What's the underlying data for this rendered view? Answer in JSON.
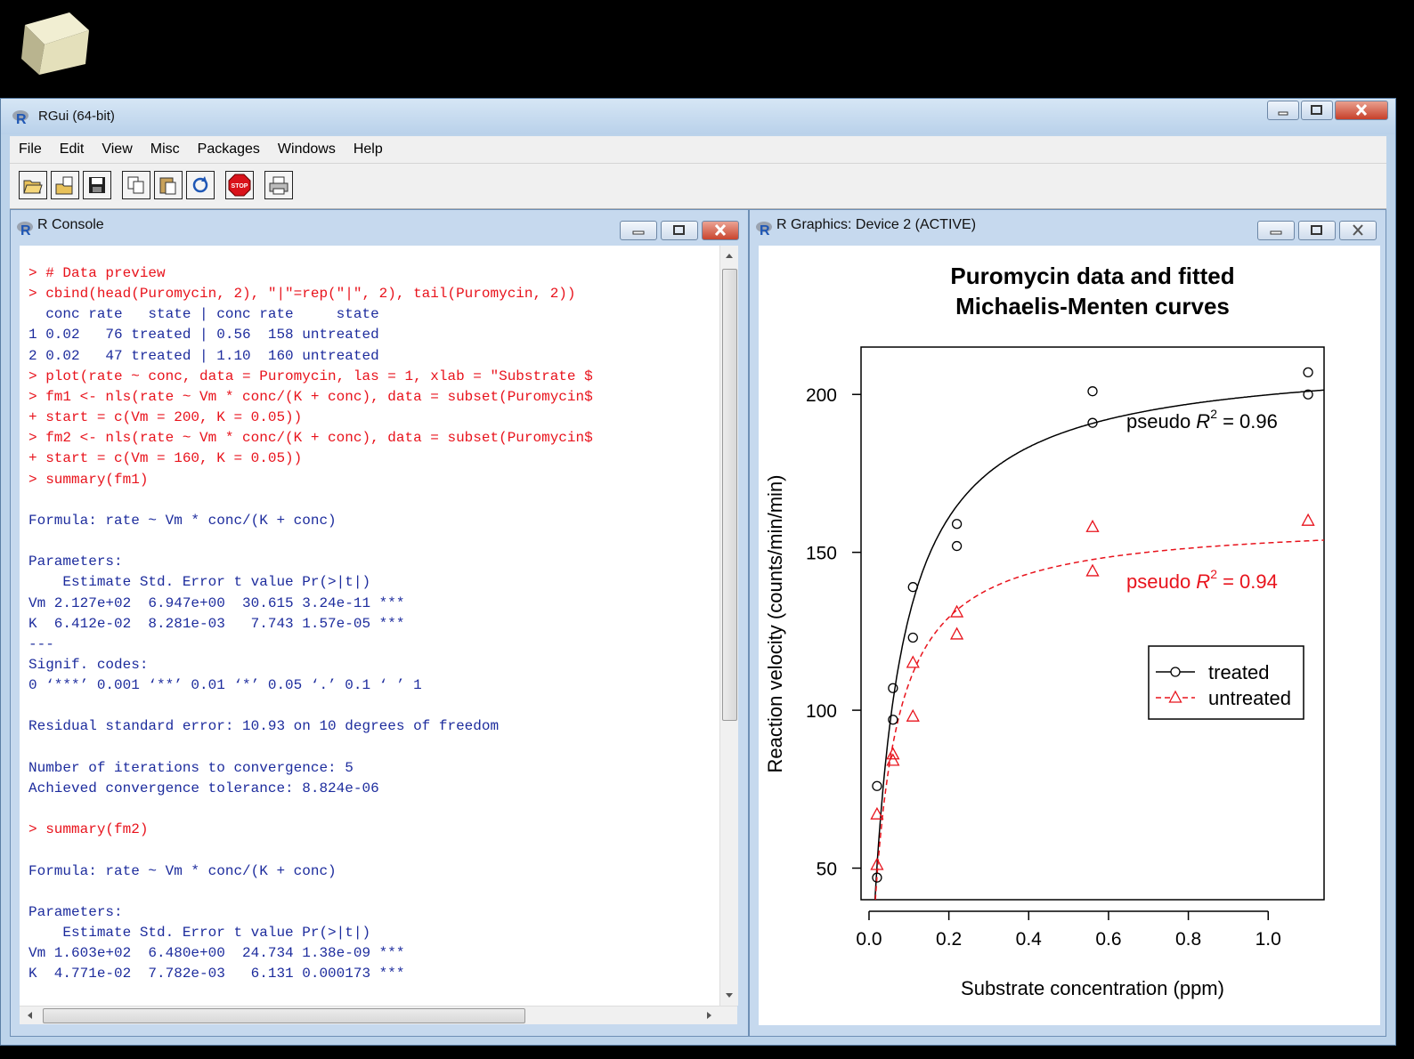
{
  "app": {
    "title": "RGui (64-bit)",
    "menu": [
      "File",
      "Edit",
      "View",
      "Misc",
      "Packages",
      "Windows",
      "Help"
    ],
    "toolbar_icons": [
      "open-script-icon",
      "load-workspace-icon",
      "save-workspace-icon",
      "copy-icon",
      "paste-icon",
      "refresh-icon",
      "stop-icon",
      "print-icon"
    ],
    "stop_label": "STOP"
  },
  "console": {
    "title": "R Console",
    "lines": [
      {
        "t": "in",
        "s": "> # Data preview"
      },
      {
        "t": "in",
        "s": "> cbind(head(Puromycin, 2), \"|\"=rep(\"|\", 2), tail(Puromycin, 2))"
      },
      {
        "t": "out",
        "s": "  conc rate   state | conc rate     state"
      },
      {
        "t": "out",
        "s": "1 0.02   76 treated | 0.56  158 untreated"
      },
      {
        "t": "out",
        "s": "2 0.02   47 treated | 1.10  160 untreated"
      },
      {
        "t": "in",
        "s": "> plot(rate ~ conc, data = Puromycin, las = 1, xlab = \"Substrate $"
      },
      {
        "t": "in",
        "s": "> fm1 <- nls(rate ~ Vm * conc/(K + conc), data = subset(Puromycin$"
      },
      {
        "t": "in",
        "s": "+ start = c(Vm = 200, K = 0.05))"
      },
      {
        "t": "in",
        "s": "> fm2 <- nls(rate ~ Vm * conc/(K + conc), data = subset(Puromycin$"
      },
      {
        "t": "in",
        "s": "+ start = c(Vm = 160, K = 0.05))"
      },
      {
        "t": "in",
        "s": "> summary(fm1)"
      },
      {
        "t": "out",
        "s": ""
      },
      {
        "t": "out",
        "s": "Formula: rate ~ Vm * conc/(K + conc)"
      },
      {
        "t": "out",
        "s": ""
      },
      {
        "t": "out",
        "s": "Parameters:"
      },
      {
        "t": "out",
        "s": "    Estimate Std. Error t value Pr(>|t|)"
      },
      {
        "t": "out",
        "s": "Vm 2.127e+02  6.947e+00  30.615 3.24e-11 ***"
      },
      {
        "t": "out",
        "s": "K  6.412e-02  8.281e-03   7.743 1.57e-05 ***"
      },
      {
        "t": "out",
        "s": "---"
      },
      {
        "t": "out",
        "s": "Signif. codes:"
      },
      {
        "t": "out",
        "s": "0 ‘***’ 0.001 ‘**’ 0.01 ‘*’ 0.05 ‘.’ 0.1 ‘ ’ 1"
      },
      {
        "t": "out",
        "s": ""
      },
      {
        "t": "out",
        "s": "Residual standard error: 10.93 on 10 degrees of freedom"
      },
      {
        "t": "out",
        "s": ""
      },
      {
        "t": "out",
        "s": "Number of iterations to convergence: 5"
      },
      {
        "t": "out",
        "s": "Achieved convergence tolerance: 8.824e-06"
      },
      {
        "t": "out",
        "s": ""
      },
      {
        "t": "in",
        "s": "> summary(fm2)"
      },
      {
        "t": "out",
        "s": ""
      },
      {
        "t": "out",
        "s": "Formula: rate ~ Vm * conc/(K + conc)"
      },
      {
        "t": "out",
        "s": ""
      },
      {
        "t": "out",
        "s": "Parameters:"
      },
      {
        "t": "out",
        "s": "    Estimate Std. Error t value Pr(>|t|)"
      },
      {
        "t": "out",
        "s": "Vm 1.603e+02  6.480e+00  24.734 1.38e-09 ***"
      },
      {
        "t": "out",
        "s": "K  4.771e-02  7.782e-03   6.131 0.000173 ***"
      }
    ]
  },
  "graphics": {
    "title": "R Graphics: Device 2 (ACTIVE)"
  },
  "chart_data": {
    "type": "scatter",
    "title": "Puromycin data and fitted",
    "subtitle": "Michaelis-Menten curves",
    "xlabel": "Substrate concentration (ppm)",
    "ylabel": "Reaction velocity (counts/min/min)",
    "xlim": [
      -0.02,
      1.14
    ],
    "ylim": [
      40,
      215
    ],
    "xticks": [
      "0.0",
      "0.2",
      "0.4",
      "0.6",
      "0.8",
      "1.0"
    ],
    "yticks": [
      "50",
      "100",
      "150",
      "200"
    ],
    "legend_position": "right",
    "series": [
      {
        "name": "treated",
        "color": "#000000",
        "marker": "circle",
        "line": "solid",
        "x": [
          0.02,
          0.02,
          0.06,
          0.06,
          0.11,
          0.11,
          0.22,
          0.22,
          0.56,
          0.56,
          1.1,
          1.1
        ],
        "y": [
          76,
          47,
          97,
          107,
          123,
          139,
          159,
          152,
          191,
          201,
          207,
          200
        ],
        "fit": {
          "Vm": 212.7,
          "K": 0.06412
        },
        "annotation": {
          "prefix": "pseudo ",
          "var": "R",
          "sup": "2",
          "value": " = 0.96"
        }
      },
      {
        "name": "untreated",
        "color": "#e8131c",
        "marker": "triangle",
        "line": "dashed",
        "x": [
          0.02,
          0.02,
          0.06,
          0.06,
          0.11,
          0.11,
          0.22,
          0.22,
          0.56,
          0.56,
          1.1
        ],
        "y": [
          67,
          51,
          84,
          86,
          98,
          115,
          131,
          124,
          144,
          158,
          160
        ],
        "fit": {
          "Vm": 160.3,
          "K": 0.04771
        },
        "annotation": {
          "prefix": "pseudo ",
          "var": "R",
          "sup": "2",
          "value": " = 0.94"
        }
      }
    ]
  }
}
